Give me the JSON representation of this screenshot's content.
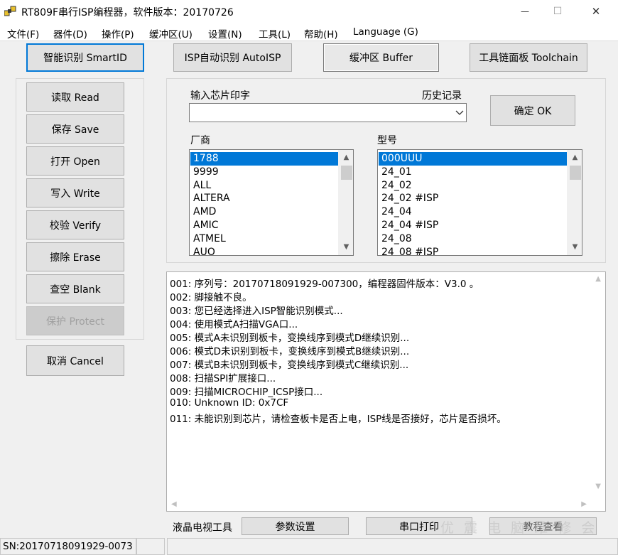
{
  "window": {
    "title": "RT809F串行ISP编程器，软件版本：20170726",
    "minimize_glyph": "—",
    "maximize_glyph": "☐",
    "close_glyph": "✕"
  },
  "menu": [
    {
      "label": "文件(F)"
    },
    {
      "label": "器件(D)"
    },
    {
      "label": "操作(P)"
    },
    {
      "label": "缓冲区(U)"
    },
    {
      "label": "设置(N)"
    },
    {
      "label": "工具(L)"
    },
    {
      "label": "帮助(H)"
    },
    {
      "label": "Language (G)"
    }
  ],
  "top_buttons": {
    "smartid": "智能识别 SmartID",
    "autoisp": "ISP自动识别 AutoISP",
    "buffer": "缓冲区 Buffer",
    "toolchain": "工具链面板 Toolchain"
  },
  "side_buttons": {
    "read": "读取 Read",
    "save": "保存 Save",
    "open": "打开 Open",
    "write": "写入 Write",
    "verify": "校验 Verify",
    "erase": "擦除 Erase",
    "blank": "查空 Blank",
    "protect": "保护 Protect",
    "cancel": "取消 Cancel"
  },
  "chip_input": {
    "label": "输入芯片印字",
    "history_label": "历史记录",
    "value": "",
    "ok_button": "确定 OK"
  },
  "vendor_list": {
    "label": "厂商",
    "items": [
      "1788",
      "9999",
      "ALL",
      "ALTERA",
      "AMD",
      "AMIC",
      "ATMEL",
      "AUO"
    ],
    "selected_index": 0
  },
  "model_list": {
    "label": "型号",
    "items": [
      "000UUU",
      "24_01",
      "24_02",
      "24_02 #ISP",
      "24_04",
      "24_04 #ISP",
      "24_08",
      "24_08 #ISP"
    ],
    "selected_index": 0
  },
  "log": [
    "001: 序列号：20170718091929-007300，编程器固件版本：V3.0 。",
    "002: 脚接触不良。",
    "003: 您已经选择进入ISP智能识别模式...",
    "004: 使用模式A扫描VGA口...",
    "005: 模式A未识别到板卡，变换线序到模式D继续识别...",
    "006: 模式D未识别到板卡，变换线序到模式B继续识别...",
    "007: 模式B未识别到板卡，变换线序到模式C继续识别...",
    "008: 扫描SPI扩展接口...",
    "009: 扫描MICROCHIP_ICSP接口...",
    "010: Unknown ID: 0x7CF",
    "011: 未能识别到芯片，请检查板卡是否上电，ISP线是否接好，芯片是否损坏。"
  ],
  "bottom_bar": {
    "lcd_tools_label": "液晶电视工具",
    "params_button": "参数设置",
    "serial_print_button": "串口打印",
    "tutorial_button": "教程查看",
    "watermark": "优 震 电 脑 维 修 会"
  },
  "status_bar": {
    "serial": "SN:20170718091929-0073",
    "pane2": "",
    "pane3": ""
  },
  "colors": {
    "accent": "#0078d7",
    "app_icon_yellow": "#e8c02c",
    "app_icon_dark": "#3a3a3a"
  },
  "icons": [
    "app-icon",
    "minimize-icon",
    "maximize-icon",
    "close-icon",
    "dropdown-arrow-icon",
    "scroll-up-icon",
    "scroll-down-icon",
    "scroll-left-icon",
    "scroll-right-icon"
  ]
}
